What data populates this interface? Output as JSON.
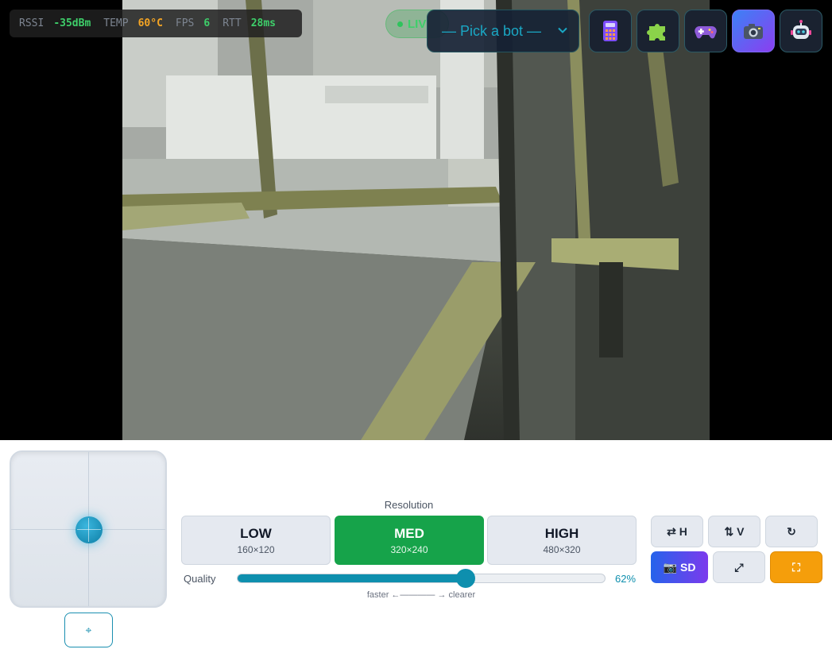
{
  "telemetry": {
    "rssi_label": "RSSI",
    "rssi_value": "-35dBm",
    "temp_label": "TEMP",
    "temp_value": "60°C",
    "fps_label": "FPS",
    "fps_value": "6",
    "rtt_label": "RTT",
    "rtt_value": "28ms",
    "colors": {
      "good": "#3ecf6a",
      "warn": "#f5a524"
    }
  },
  "live_badge": "LIV",
  "bot_picker": {
    "value": "— Pick a bot —"
  },
  "toolbar": [
    {
      "name": "calculator-icon"
    },
    {
      "name": "puzzle-icon"
    },
    {
      "name": "gamepad-icon"
    },
    {
      "name": "camera-icon",
      "active": true
    },
    {
      "name": "robot-icon"
    }
  ],
  "joystick": {
    "center_icon": "⌖"
  },
  "resolution": {
    "label": "Resolution",
    "options": [
      {
        "name": "LOW",
        "dim": "160×120"
      },
      {
        "name": "MED",
        "dim": "320×240",
        "active": true
      },
      {
        "name": "HIGH",
        "dim": "480×320"
      }
    ]
  },
  "quality": {
    "label": "Quality",
    "value": 0.62,
    "value_text": "62%",
    "hint": "faster ←———— → clearer"
  },
  "side_buttons": {
    "flip_h": "⇄ H",
    "flip_v": "⇅ V",
    "rotate": "↻",
    "sd_icon": "📷",
    "sd_label": "SD",
    "expand": "⤢",
    "fullscreen": "⛶"
  },
  "accent_color": "#0e8fae"
}
